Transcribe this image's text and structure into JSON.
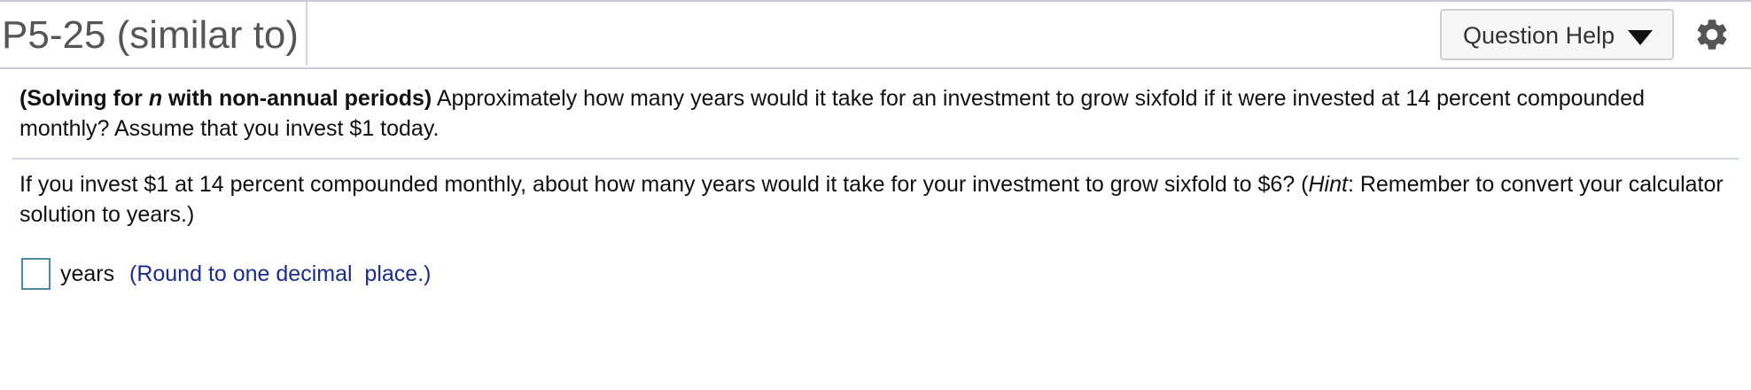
{
  "header": {
    "title": "P5-25 (similar to)",
    "help_button_label": "Question Help",
    "caret_icon": "caret-down-icon",
    "settings_icon": "gear-icon"
  },
  "problem": {
    "heading_open": "(Solving for ",
    "heading_var": "n",
    "heading_close": " with non-annual periods)",
    "body": "  Approximately how many years would it take for an investment to grow sixfold if it were invested at 14 percent compounded monthly?  Assume that you invest $1 today."
  },
  "question": {
    "text_before": "If you invest $1 at 14 percent compounded monthly, about how many years would it take for your investment to grow sixfold to $6?  (",
    "hint_label": "Hint",
    "text_after": ":  Remember to convert your calculator solution to years.)"
  },
  "answer": {
    "value": "",
    "unit": "years",
    "instruction": "(Round to one decimal  place.)"
  },
  "colors": {
    "instruction_text": "#1a2d8c",
    "input_border": "#4c8ba3",
    "rule": "#c9cbd6"
  }
}
